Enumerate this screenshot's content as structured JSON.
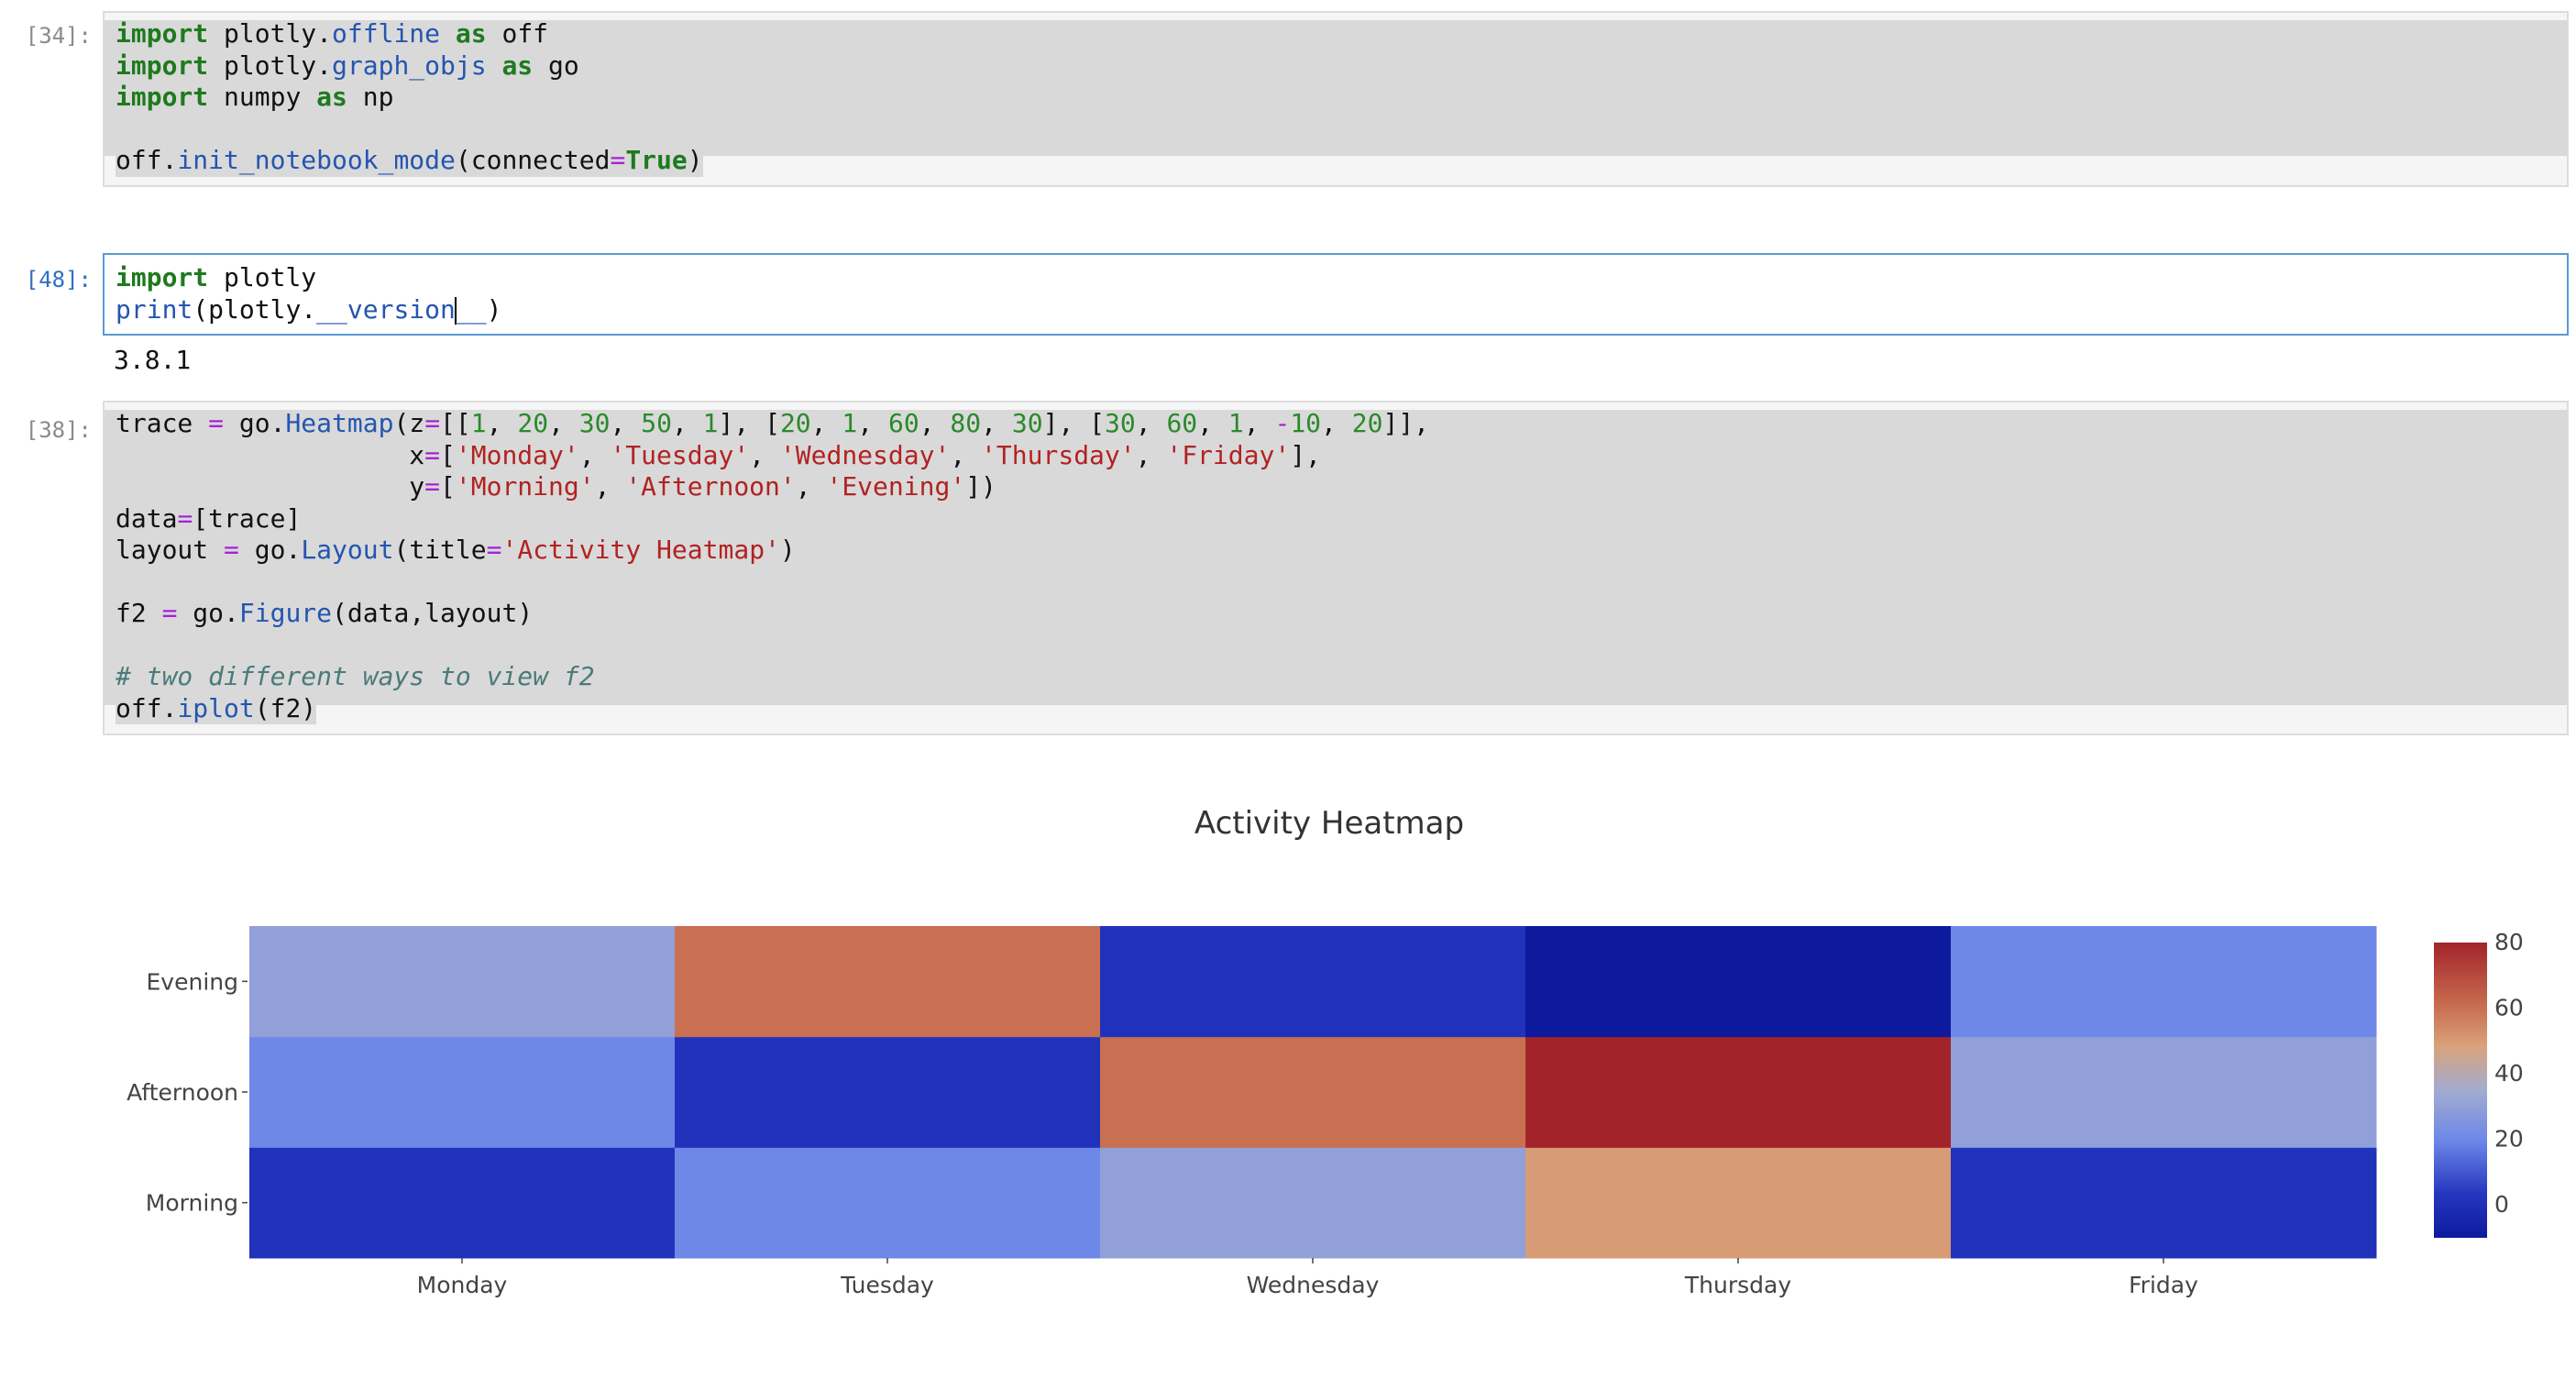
{
  "cells": [
    {
      "prompt": "[34]:",
      "code_lines": [
        [
          [
            "kw",
            "import"
          ],
          [
            "p",
            " plotly."
          ],
          [
            "fn",
            "offline"
          ],
          [
            "p",
            " "
          ],
          [
            "kw",
            "as"
          ],
          [
            "p",
            " off"
          ]
        ],
        [
          [
            "kw",
            "import"
          ],
          [
            "p",
            " plotly."
          ],
          [
            "fn",
            "graph_objs"
          ],
          [
            "p",
            " "
          ],
          [
            "kw",
            "as"
          ],
          [
            "p",
            " go"
          ]
        ],
        [
          [
            "kw",
            "import"
          ],
          [
            "p",
            " numpy "
          ],
          [
            "kw",
            "as"
          ],
          [
            "p",
            " np"
          ]
        ],
        [],
        [
          [
            "p",
            "off."
          ],
          [
            "fn",
            "init_notebook_mode"
          ],
          [
            "p",
            "(connected"
          ],
          [
            "op",
            "="
          ],
          [
            "kw",
            "True"
          ],
          [
            "p",
            ")"
          ]
        ]
      ]
    },
    {
      "prompt": "[48]:",
      "code_lines": [
        [
          [
            "kw",
            "import"
          ],
          [
            "p",
            " plotly"
          ]
        ],
        [
          [
            "fn",
            "print"
          ],
          [
            "p",
            "(plotly."
          ],
          [
            "fn",
            "__version"
          ],
          [
            "caret",
            ""
          ],
          [
            "fn",
            "__"
          ],
          [
            "p",
            ")"
          ]
        ]
      ],
      "output": "3.8.1"
    },
    {
      "prompt": "[38]:",
      "code_lines": [
        [
          [
            "p",
            "trace "
          ],
          [
            "op",
            "="
          ],
          [
            "p",
            " go."
          ],
          [
            "fn",
            "Heatmap"
          ],
          [
            "p",
            "(z"
          ],
          [
            "op",
            "="
          ],
          [
            "p",
            "[["
          ],
          [
            "num",
            "1"
          ],
          [
            "p",
            ", "
          ],
          [
            "num",
            "20"
          ],
          [
            "p",
            ", "
          ],
          [
            "num",
            "30"
          ],
          [
            "p",
            ", "
          ],
          [
            "num",
            "50"
          ],
          [
            "p",
            ", "
          ],
          [
            "num",
            "1"
          ],
          [
            "p",
            "], ["
          ],
          [
            "num",
            "20"
          ],
          [
            "p",
            ", "
          ],
          [
            "num",
            "1"
          ],
          [
            "p",
            ", "
          ],
          [
            "num",
            "60"
          ],
          [
            "p",
            ", "
          ],
          [
            "num",
            "80"
          ],
          [
            "p",
            ", "
          ],
          [
            "num",
            "30"
          ],
          [
            "p",
            "], ["
          ],
          [
            "num",
            "30"
          ],
          [
            "p",
            ", "
          ],
          [
            "num",
            "60"
          ],
          [
            "p",
            ", "
          ],
          [
            "num",
            "1"
          ],
          [
            "p",
            ", "
          ],
          [
            "op",
            "-"
          ],
          [
            "num",
            "10"
          ],
          [
            "p",
            ", "
          ],
          [
            "num",
            "20"
          ],
          [
            "p",
            "]],"
          ]
        ],
        [
          [
            "p",
            "                   x"
          ],
          [
            "op",
            "="
          ],
          [
            "p",
            "["
          ],
          [
            "str",
            "'Monday'"
          ],
          [
            "p",
            ", "
          ],
          [
            "str",
            "'Tuesday'"
          ],
          [
            "p",
            ", "
          ],
          [
            "str",
            "'Wednesday'"
          ],
          [
            "p",
            ", "
          ],
          [
            "str",
            "'Thursday'"
          ],
          [
            "p",
            ", "
          ],
          [
            "str",
            "'Friday'"
          ],
          [
            "p",
            "],"
          ]
        ],
        [
          [
            "p",
            "                   y"
          ],
          [
            "op",
            "="
          ],
          [
            "p",
            "["
          ],
          [
            "str",
            "'Morning'"
          ],
          [
            "p",
            ", "
          ],
          [
            "str",
            "'Afternoon'"
          ],
          [
            "p",
            ", "
          ],
          [
            "str",
            "'Evening'"
          ],
          [
            "p",
            "])"
          ]
        ],
        [
          [
            "p",
            "data"
          ],
          [
            "op",
            "="
          ],
          [
            "p",
            "[trace]"
          ]
        ],
        [
          [
            "p",
            "layout "
          ],
          [
            "op",
            "="
          ],
          [
            "p",
            " go."
          ],
          [
            "fn",
            "Layout"
          ],
          [
            "p",
            "(title"
          ],
          [
            "op",
            "="
          ],
          [
            "str",
            "'Activity Heatmap'"
          ],
          [
            "p",
            ")"
          ]
        ],
        [],
        [
          [
            "p",
            "f2 "
          ],
          [
            "op",
            "="
          ],
          [
            "p",
            " go."
          ],
          [
            "fn",
            "Figure"
          ],
          [
            "p",
            "(data,layout)"
          ]
        ],
        [],
        [
          [
            "cm",
            "# two different ways to view f2"
          ]
        ],
        [
          [
            "p",
            "off."
          ],
          [
            "fn",
            "iplot"
          ],
          [
            "p",
            "(f2)"
          ]
        ]
      ]
    }
  ],
  "chart_data": {
    "type": "heatmap",
    "title": "Activity Heatmap",
    "x": [
      "Monday",
      "Tuesday",
      "Wednesday",
      "Thursday",
      "Friday"
    ],
    "y": [
      "Morning",
      "Afternoon",
      "Evening"
    ],
    "z": [
      [
        1,
        20,
        30,
        50,
        1
      ],
      [
        20,
        1,
        60,
        80,
        30
      ],
      [
        30,
        60,
        1,
        -10,
        20
      ]
    ],
    "zrange": [
      -10,
      80
    ],
    "colorbar_ticks": [
      0,
      20,
      40,
      60,
      80
    ],
    "colorscale": [
      [
        0,
        "#0e1a9e"
      ],
      [
        0.15,
        "#2537c0"
      ],
      [
        0.33,
        "#6d87e8"
      ],
      [
        0.5,
        "#a3acd0"
      ],
      [
        0.65,
        "#d9a27a"
      ],
      [
        0.78,
        "#c96f51"
      ],
      [
        1,
        "#a2242a"
      ]
    ]
  }
}
